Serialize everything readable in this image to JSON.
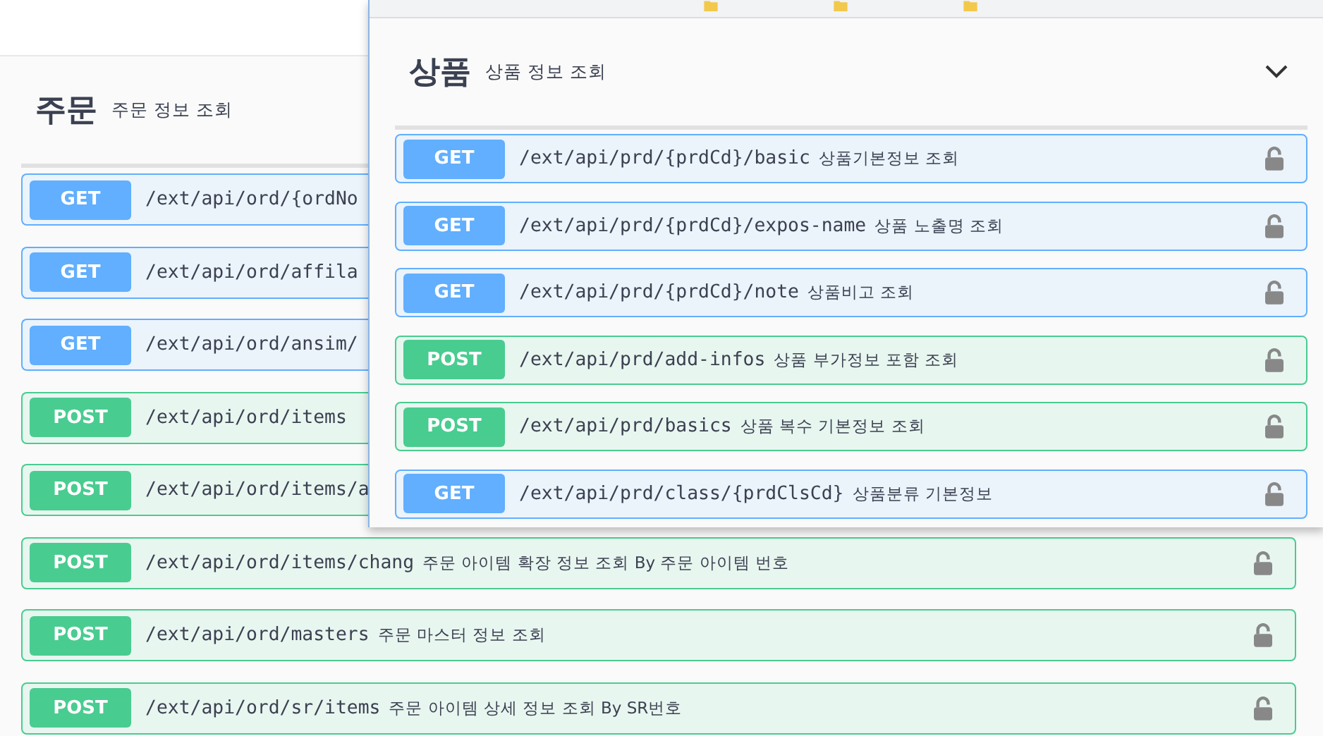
{
  "back_section": {
    "title": "주문",
    "description": "주문 정보 조회",
    "operations": [
      {
        "method": "GET",
        "path": "/ext/api/ord/{ordNo"
      },
      {
        "method": "GET",
        "path": "/ext/api/ord/affila"
      },
      {
        "method": "GET",
        "path": "/ext/api/ord/ansim/"
      },
      {
        "method": "POST",
        "path": "/ext/api/ord/items"
      },
      {
        "method": "POST",
        "path": "/ext/api/ord/items/a"
      },
      {
        "method": "POST",
        "path": "/ext/api/ord/items/chang",
        "summary": "주문 아이템 확장 정보 조회 By 주문 아이템 번호",
        "locked": false
      },
      {
        "method": "POST",
        "path": "/ext/api/ord/masters",
        "summary": "주문 마스터 정보 조회",
        "locked": false
      },
      {
        "method": "POST",
        "path": "/ext/api/ord/sr/items",
        "summary": "주문 아이템 상세 정보 조회 By SR번호",
        "locked": false
      }
    ]
  },
  "front_window": {
    "section": {
      "title": "상품",
      "description": "상품 정보 조회",
      "expanded": true,
      "operations": [
        {
          "method": "GET",
          "path": "/ext/api/prd/{prdCd}/basic",
          "summary": "상품기본정보 조회",
          "locked": false
        },
        {
          "method": "GET",
          "path": "/ext/api/prd/{prdCd}/expos-name",
          "summary": "상품 노출명 조회",
          "locked": false
        },
        {
          "method": "GET",
          "path": "/ext/api/prd/{prdCd}/note",
          "summary": "상품비고 조회",
          "locked": false
        },
        {
          "method": "POST",
          "path": "/ext/api/prd/add-infos",
          "summary": "상품 부가정보 포함 조회",
          "locked": false
        },
        {
          "method": "POST",
          "path": "/ext/api/prd/basics",
          "summary": "상품 복수 기본정보 조회",
          "locked": false
        },
        {
          "method": "GET",
          "path": "/ext/api/prd/class/{prdClsCd}",
          "summary": "상품분류 기본정보",
          "locked": false
        }
      ]
    }
  }
}
